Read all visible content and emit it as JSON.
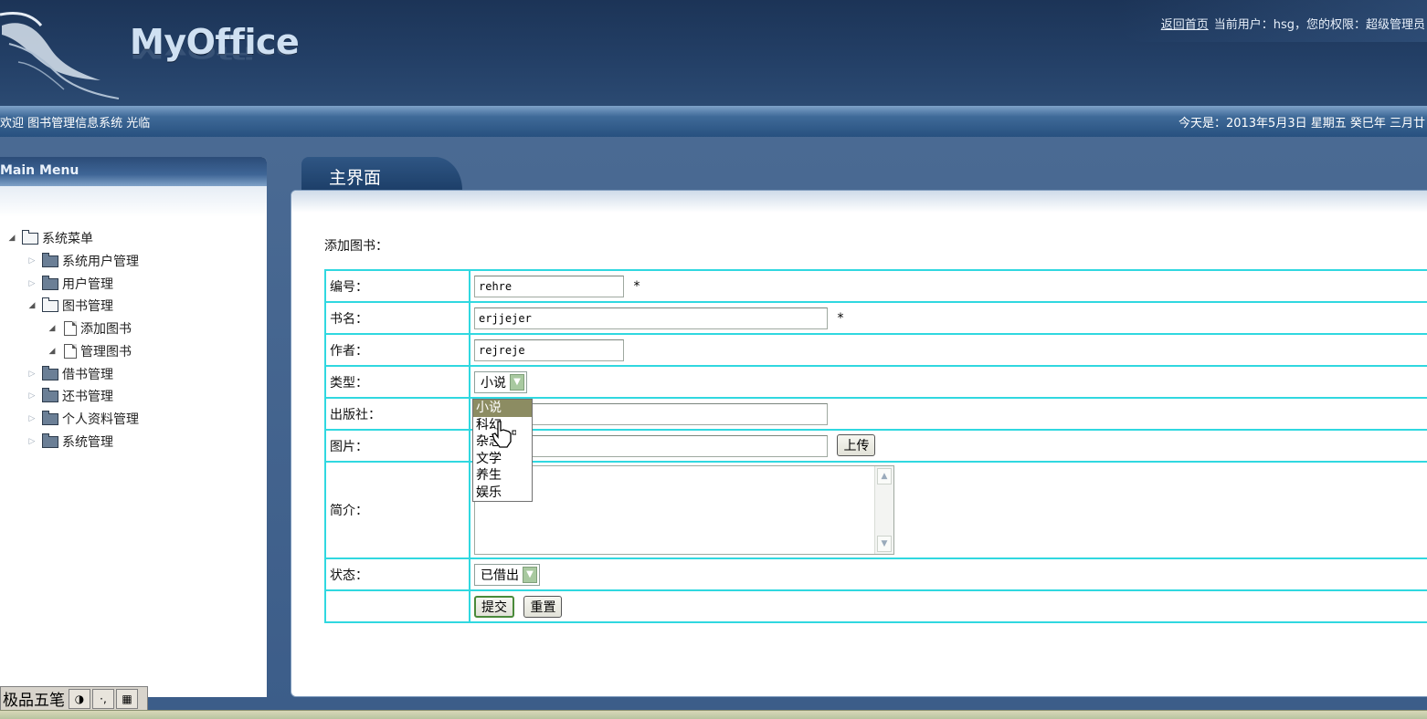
{
  "header": {
    "logo_text": "MyOffice",
    "home_link": "返回首页",
    "user_info": "当前用户：hsg，您的权限：超级管理员"
  },
  "welcome_bar": {
    "welcome": "欢迎 图书管理信息系统 光临",
    "date": "今天是：2013年5月3日 星期五 癸巳年 三月廿"
  },
  "sidebar": {
    "title": "Main Menu",
    "items": [
      {
        "label": "系统菜单",
        "level": 0,
        "expanded": true,
        "type": "folder"
      },
      {
        "label": "系统用户管理",
        "level": 1,
        "expanded": false,
        "type": "folder"
      },
      {
        "label": "用户管理",
        "level": 1,
        "expanded": false,
        "type": "folder"
      },
      {
        "label": "图书管理",
        "level": 1,
        "expanded": true,
        "type": "folder"
      },
      {
        "label": "添加图书",
        "level": 2,
        "expanded": true,
        "type": "file"
      },
      {
        "label": "管理图书",
        "level": 2,
        "expanded": true,
        "type": "file"
      },
      {
        "label": "借书管理",
        "level": 1,
        "expanded": false,
        "type": "folder"
      },
      {
        "label": "还书管理",
        "level": 1,
        "expanded": false,
        "type": "folder"
      },
      {
        "label": "个人资料管理",
        "level": 1,
        "expanded": false,
        "type": "folder"
      },
      {
        "label": "系统管理",
        "level": 1,
        "expanded": false,
        "type": "folder"
      }
    ]
  },
  "tab": {
    "label": "主界面"
  },
  "form": {
    "title": "添加图书：",
    "labels": {
      "id": "编号：",
      "name": "书名：",
      "author": "作者：",
      "type": "类型：",
      "publisher": "出版社：",
      "image": "图片：",
      "intro": "简介：",
      "status": "状态："
    },
    "values": {
      "id": "rehre",
      "name": "erjjejer",
      "author": "rejreje",
      "publisher": "",
      "image": "",
      "intro": ""
    },
    "required_mark": "*",
    "type_select": {
      "selected": "小说",
      "options": [
        "小说",
        "科幻",
        "杂志",
        "文学",
        "养生",
        "娱乐"
      ]
    },
    "status_select": {
      "selected": "已借出"
    },
    "upload_button": "上传",
    "submit_button": "提交",
    "reset_button": "重置"
  },
  "ime": {
    "name": "极品五笔"
  },
  "colors": {
    "header_bg": "#1c3457",
    "table_border": "#30d8e0",
    "dropdown_selected": "#8c8c62"
  }
}
